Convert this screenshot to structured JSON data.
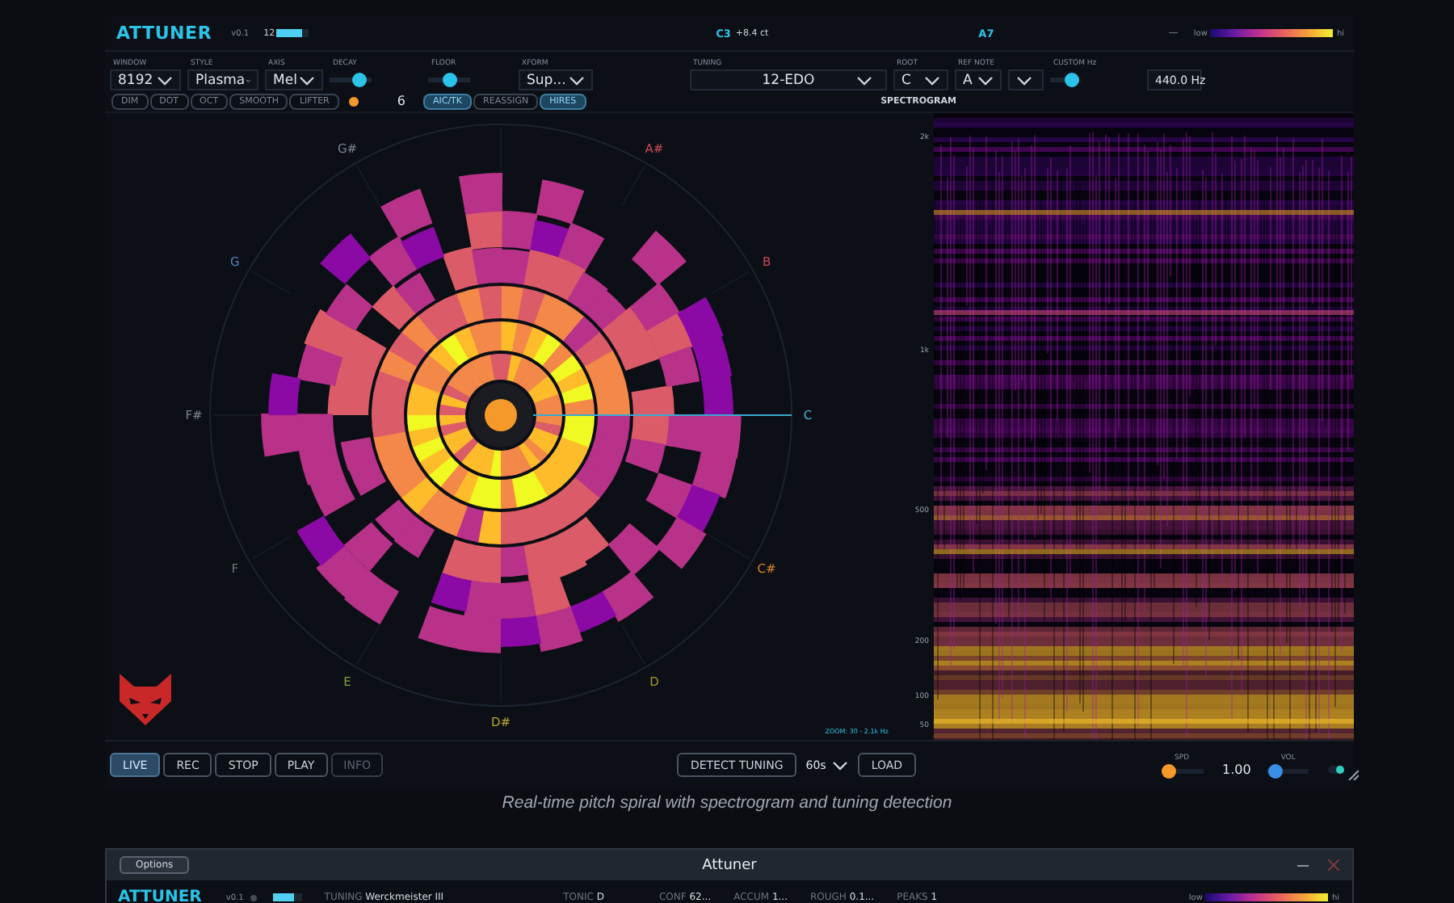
{
  "app": {
    "title": "ATTUNER",
    "version": "v0.1",
    "input_reading": "12",
    "input_meter": {
      "level": 0.8
    },
    "note": "C3",
    "cents": "+8.4 ct",
    "target": "A7",
    "dash": "—",
    "colorbar": {
      "low": "low",
      "high": "hi"
    }
  },
  "controls": [
    {
      "kind": "dropdown",
      "label": "WINDOW",
      "value": "8192"
    },
    {
      "kind": "dropdown",
      "label": "STYLE",
      "value": "Plasma"
    },
    {
      "kind": "dropdown",
      "label": "AXIS",
      "value": "Mel"
    },
    {
      "kind": "slider",
      "label": "DECAY",
      "level": 0.8
    },
    {
      "kind": "slider",
      "label": "FLOOR",
      "level": 0.5
    },
    {
      "kind": "dropdown",
      "label": "XFORM",
      "value": "Sup..."
    },
    {
      "kind": "dropdown",
      "label": "TUNING",
      "value": "12-EDO"
    },
    {
      "kind": "dropdown",
      "label": "ROOT",
      "value": "C"
    },
    {
      "kind": "dropdown",
      "label": "REF NOTE",
      "value": "A"
    },
    {
      "kind": "dropdown"
    },
    {
      "kind": "toggle",
      "label": "CUSTOM Hz",
      "on": true
    },
    {
      "kind": "field",
      "value": "440.0 Hz"
    }
  ],
  "view_toggles": [
    {
      "label": "DIM",
      "selected": false
    },
    {
      "label": "DOT",
      "selected": false
    },
    {
      "label": "OCT",
      "selected": false
    },
    {
      "label": "SMOOTH",
      "selected": false
    },
    {
      "label": "LIFTER",
      "selected": false
    }
  ],
  "harmonics": "6",
  "mode_toggles": [
    {
      "label": "AIC/TK",
      "selected": true
    },
    {
      "label": "REASSIGN",
      "selected": false
    },
    {
      "label": "HIRES",
      "selected": true
    }
  ],
  "spiral": {
    "notes": [
      {
        "label": "C",
        "color": "#3fb8e0"
      },
      {
        "label": "C#",
        "color": "#d9822b"
      },
      {
        "label": "D",
        "color": "#a89a2a"
      },
      {
        "label": "D#",
        "color": "#b3a832"
      },
      {
        "label": "E",
        "color": "#7fa040"
      },
      {
        "label": "F",
        "color": "#6f7a70"
      },
      {
        "label": "F#",
        "color": "#7d8590"
      },
      {
        "label": "G",
        "color": "#4a86c8"
      },
      {
        "label": "G#",
        "color": "#7d8190"
      },
      {
        "label": "A#",
        "color": "#d0495a"
      },
      {
        "label": "B",
        "color": "#d0495a"
      }
    ],
    "zoom": "ZOOM: 30 - 2.1k Hz"
  },
  "spectrogram": {
    "title": "SPECTROGRAM",
    "y_labels": [
      "2k",
      "1k",
      "500",
      "200",
      "100",
      "50"
    ]
  },
  "transport": [
    {
      "label": "LIVE",
      "selected": true,
      "disabled": false
    },
    {
      "label": "REC",
      "selected": false,
      "disabled": false
    },
    {
      "label": "STOP",
      "selected": false,
      "disabled": false
    },
    {
      "label": "PLAY",
      "selected": false,
      "disabled": false
    },
    {
      "label": "INFO",
      "selected": false,
      "disabled": true
    }
  ],
  "detect": "DETECT TUNING",
  "duration": "60s",
  "load": "LOAD",
  "speed": {
    "label": "SPD",
    "level": 0.05,
    "reading": "1.00"
  },
  "volume": {
    "label": "VOL",
    "level": 0.05
  },
  "monitor": {
    "on": true
  },
  "caption": "Real-time pitch spiral with spectrogram and tuning detection",
  "window2": {
    "options": "Options",
    "title": "Attuner",
    "app": "ATTUNER",
    "version": "v0.1",
    "meter": {
      "level": 0.75
    },
    "stats": [
      {
        "label": "TUNING",
        "value": "Werckmeister III"
      },
      {
        "label": "TONIC",
        "value": "D"
      },
      {
        "label": "CONF",
        "value": "62..."
      },
      {
        "label": "ACCUM",
        "value": "1..."
      },
      {
        "label": "ROUGH",
        "value": "0.1..."
      },
      {
        "label": "PEAKS",
        "value": "1"
      }
    ],
    "colorbar": {
      "low": "low",
      "high": "hi"
    }
  }
}
